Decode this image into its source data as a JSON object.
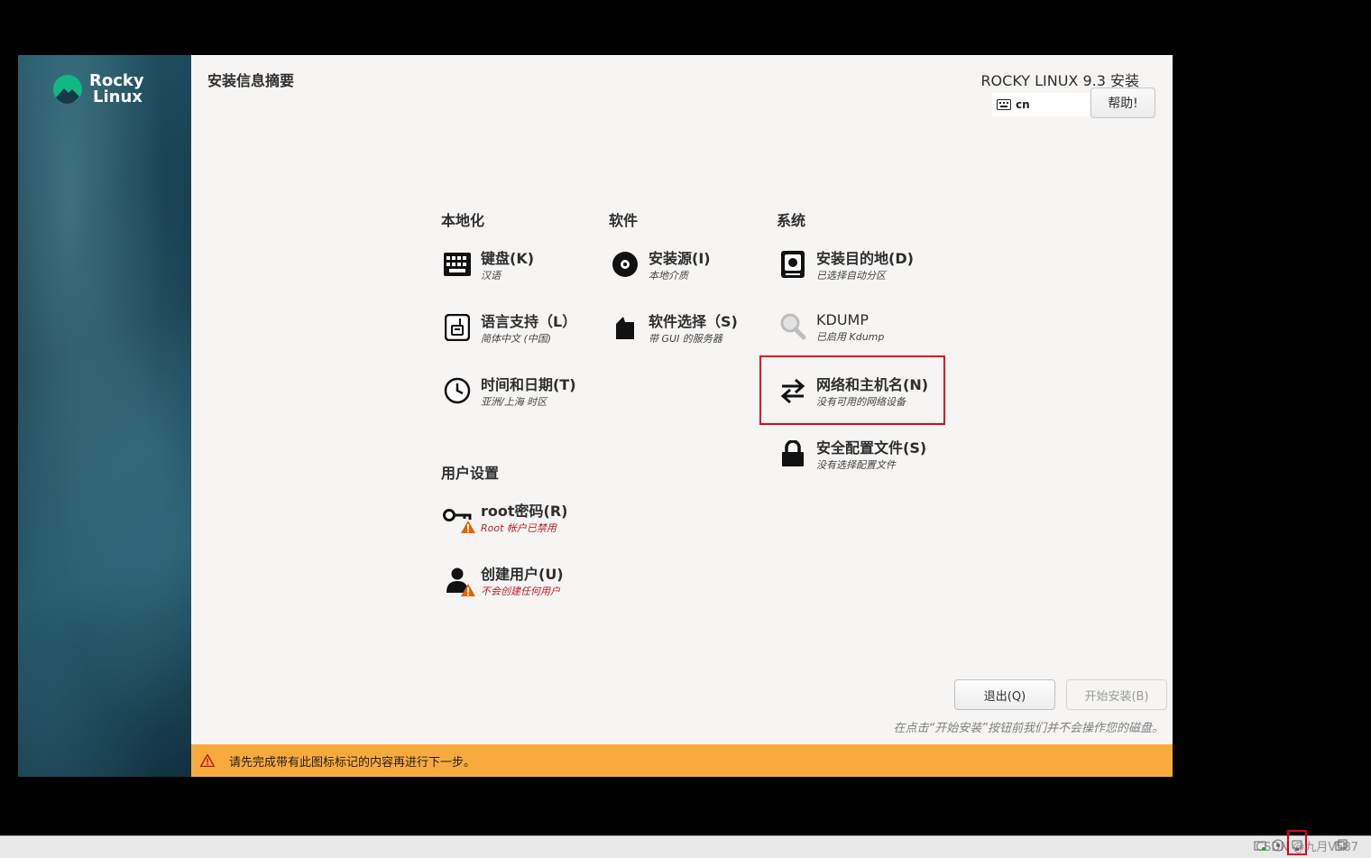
{
  "sidebar": {
    "logo_line1": "Rocky",
    "logo_line2": "Linux"
  },
  "header": {
    "page_title": "安装信息摘要",
    "product": "ROCKY LINUX 9.3 安装",
    "keyboard_layout": "cn",
    "help_label": "帮助!"
  },
  "sections": {
    "localization": "本地化",
    "software": "软件",
    "system": "系统",
    "user_settings": "用户设置"
  },
  "spokes": {
    "keyboard": {
      "name": "键盘(K)",
      "status": "汉语"
    },
    "language": {
      "name": "语言支持（L）",
      "status": "简体中文 (中国)"
    },
    "datetime": {
      "name": "时间和日期(T)",
      "status": "亚洲/上海 时区"
    },
    "source": {
      "name": "安装源(I)",
      "status": "本地介质"
    },
    "software": {
      "name": "软件选择（S)",
      "status": "带 GUI 的服务器"
    },
    "destination": {
      "name": "安装目的地(D)",
      "status": "已选择自动分区"
    },
    "kdump": {
      "name": "KDUMP",
      "status": "已启用 Kdump"
    },
    "network": {
      "name": "网络和主机名(N)",
      "status": "没有可用的网络设备"
    },
    "security": {
      "name": "安全配置文件(S)",
      "status": "没有选择配置文件"
    },
    "root": {
      "name": "root密码(R)",
      "status": "Root 帐户已禁用"
    },
    "user": {
      "name": "创建用户(U)",
      "status": "不会创建任何用户"
    }
  },
  "buttons": {
    "quit": "退出(Q)",
    "begin": "开始安装(B)"
  },
  "hint": "在点击“开始安装”按钮前我们并不会操作您的磁盘。",
  "warning": "请先完成带有此图标标记的内容再进行下一步。",
  "taskbar": {
    "watermark": "CSDN @九月V587"
  },
  "colors": {
    "warning_bar": "#f8ab3c",
    "highlight": "#e5001b",
    "error_text": "#c01c28"
  }
}
